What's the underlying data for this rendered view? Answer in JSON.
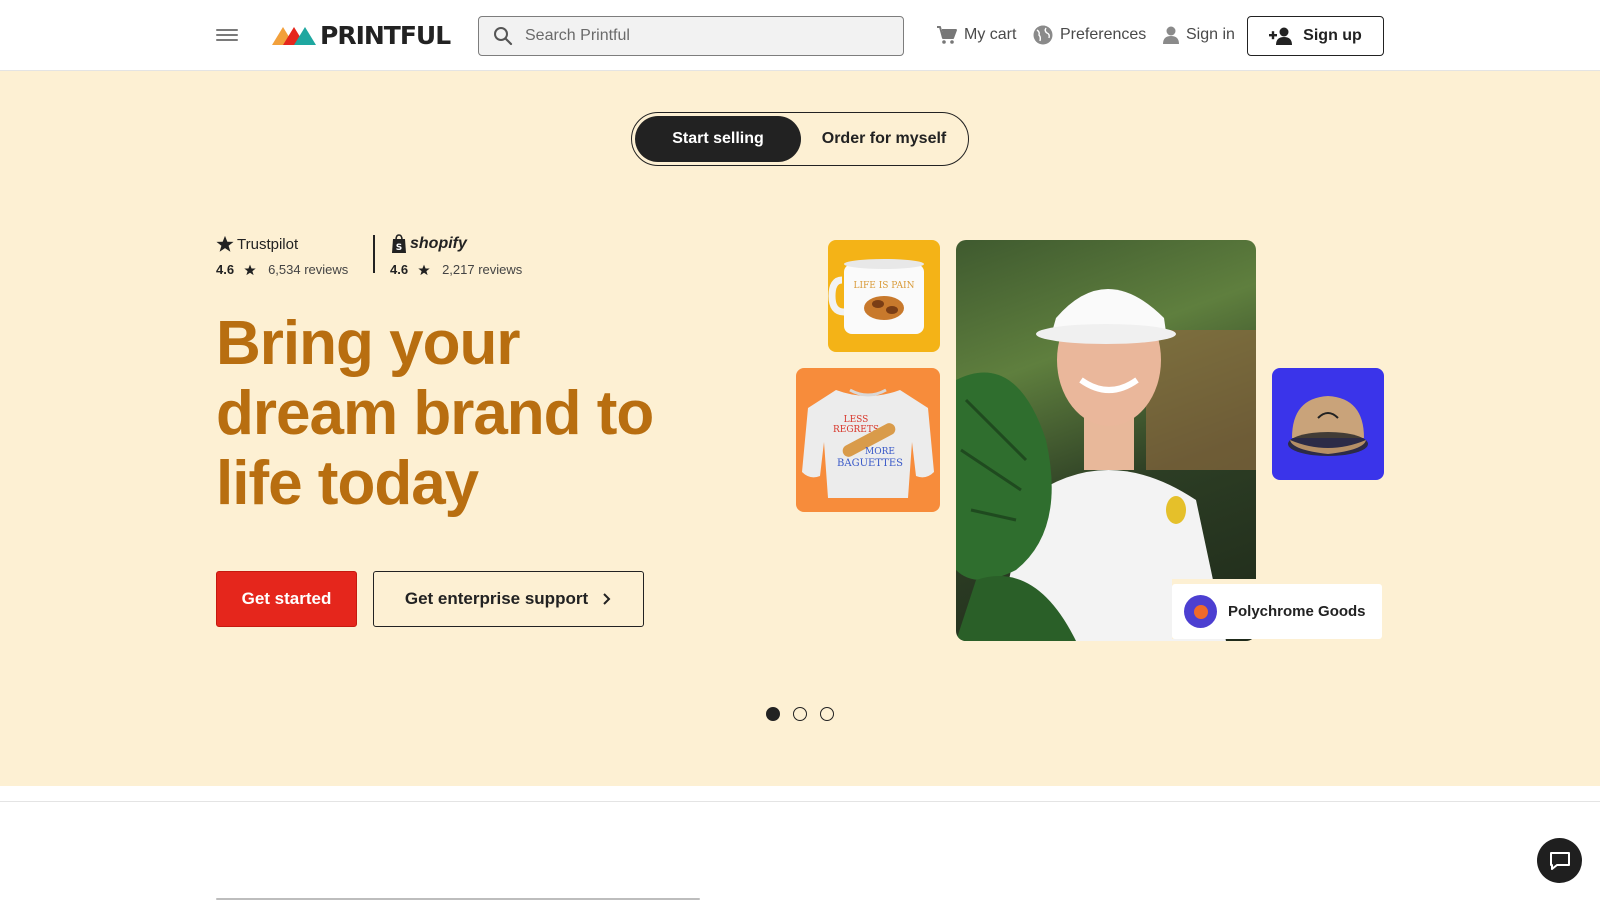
{
  "header": {
    "logo_text": "PRINTFUL",
    "search_placeholder": "Search Printful",
    "cart_label": "My cart",
    "preferences_label": "Preferences",
    "signin_label": "Sign in",
    "signup_label": "Sign up"
  },
  "hero": {
    "toggle": {
      "active": "Start selling",
      "inactive": "Order for myself"
    },
    "trustpilot": {
      "brand": "Trustpilot",
      "score": "4.6",
      "reviews": "6,534 reviews"
    },
    "shopify": {
      "brand": "shopify",
      "score": "4.6",
      "reviews": "2,217 reviews"
    },
    "headline_lines": [
      "Bring your",
      "dream brand to",
      "life today"
    ],
    "cta_primary": "Get started",
    "cta_secondary": "Get enterprise support",
    "shop_name": "Polychrome Goods",
    "mug_text": "LIFE IS PAIN",
    "sweatshirt_text": [
      "LESS",
      "REGRETS",
      "MORE",
      "BAGUETTES"
    ],
    "carousel": {
      "slides": 3,
      "active_index": 0
    }
  },
  "colors": {
    "hero_bg": "#fdf0d3",
    "headline": "#b86e10",
    "primary_cta": "#e5261c",
    "mug_tile": "#f4b317",
    "sweatshirt_tile": "#f78c3b",
    "hat_tile": "#3a34ea"
  },
  "icons": {
    "menu": "hamburger-icon",
    "search": "search-icon",
    "cart": "cart-icon",
    "preferences": "globe-icon",
    "signin": "user-icon",
    "signup": "add-user-icon",
    "chevron": "chevron-right-icon",
    "chat": "chat-icon"
  }
}
